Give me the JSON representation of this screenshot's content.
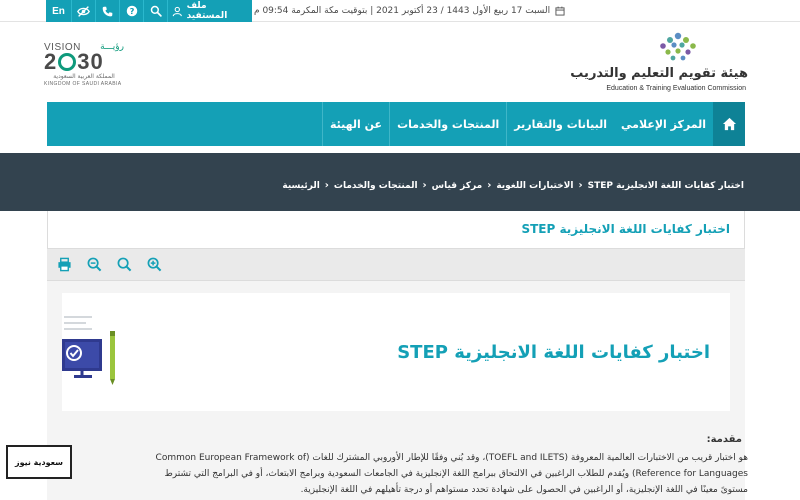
{
  "topbar": {
    "lang_label": "En",
    "profile_label": "ملف المستفيد",
    "datetime": "السبت 17 ربيع الأول 1443 / 23 أكتوبر 2021 | بتوقيت مكة المكرمة 09:54 م",
    "icons": [
      "eye-slash-icon",
      "phone-icon",
      "help-icon",
      "search-icon",
      "user-icon",
      "calendar-icon"
    ]
  },
  "branding": {
    "org_name_ar": "هيئة تقويم التعليم والتدريب",
    "org_name_en": "Education & Training Evaluation Commission",
    "vision_word": "VISION",
    "vision_ar": "رؤيـــة",
    "vision_year_a": "2",
    "vision_year_b": "30",
    "vision_sub_ar": "المملكة العربية السعودية",
    "vision_sub_en": "KINGDOM OF SAUDI ARABIA"
  },
  "nav": {
    "items": [
      "عن الهيئة",
      "المنتجات والخدمات",
      "البيانات والتقارير",
      "المركز الإعلامي"
    ]
  },
  "breadcrumb": {
    "items": [
      "الرئيسية",
      "المنتجات والخدمات",
      "مركز قياس",
      "الاختبارات اللغوية",
      "اختبار كفايات اللغة الانجليزية STEP"
    ]
  },
  "page": {
    "title": "اختبار كفايات اللغة الانجليزية STEP",
    "card_title": "اختبار كفايات اللغة الانجليزية STEP",
    "intro_label": "مقدمة:",
    "intro_lines": [
      "هو اختبار قريب من الاختبارات العالمية المعروفة (TOEFL and ILETS)، وقد بُني وفقًا للإطار الأوروبي المشترك للغات (Common European Framework of",
      "Reference for Languages) ويُقدم للطلاب الراغبين في الالتحاق ببرامج اللغة الإنجليزية في الجامعات السعودية وبرامج الابتعاث، أو في البرامج التي تشترط",
      "مستوىً معينًا في اللغة الإنجليزية، أو الراغبين في الحصول على شهادة تحدد مستواهم أو درجة تأهيلهم في اللغة الإنجليزية."
    ]
  },
  "toolbar": {
    "icons": [
      "print-icon",
      "zoom-out-icon",
      "zoom-reset-icon",
      "zoom-in-icon"
    ]
  },
  "news_badge": {
    "label": "سعودية نيوز"
  },
  "colors": {
    "accent": "#14a0b6",
    "accent_dark": "#0e8296",
    "band": "#33434f",
    "text": "#333333"
  }
}
